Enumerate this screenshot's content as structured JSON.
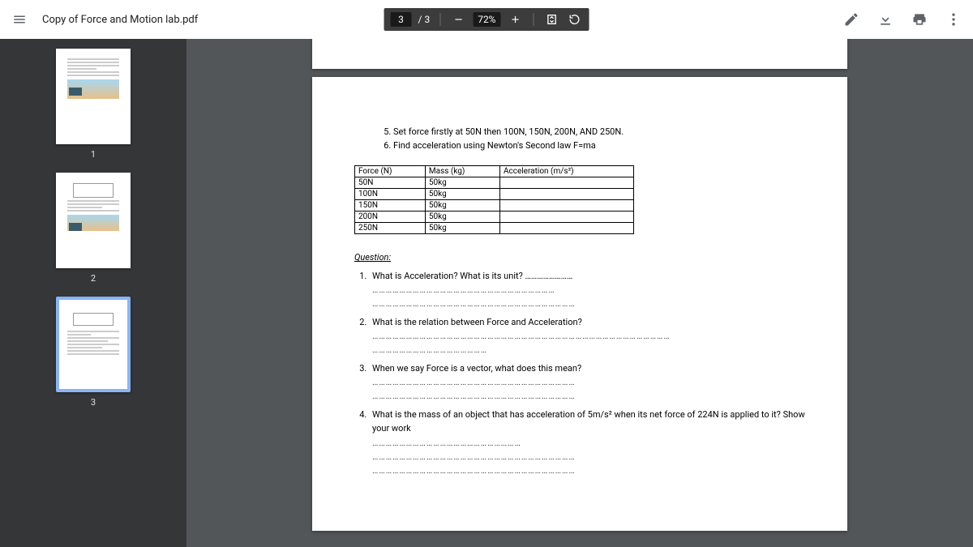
{
  "header": {
    "title": "Copy of Force and Motion lab.pdf",
    "page_current": "3",
    "page_total": "/ 3",
    "zoom": "72%"
  },
  "thumbnails": {
    "t1": "1",
    "t2": "2",
    "t3": "3"
  },
  "instructions": {
    "i5": "Set force firstly at 50N then 100N, 150N, 200N, AND 250N.",
    "i6": "Find acceleration using Newton's Second law F=ma"
  },
  "table": {
    "h1": "Force (N)",
    "h2": "Mass (kg)",
    "h3": "Acceleration (m/s²)",
    "r1c1": "50N",
    "r1c2": "50kg",
    "r2c1": "100N",
    "r2c2": "50kg",
    "r3c1": "150N",
    "r3c2": "50kg",
    "r4c1": "200N",
    "r4c2": "50kg",
    "r5c1": "250N",
    "r5c2": "50kg"
  },
  "questions": {
    "heading": "Question:",
    "q1": "What is Acceleration? What is its unit? ……………………",
    "q1b": "………………………………………………………………………",
    "q1c": "………………………………………………………………………………",
    "q2": "What is the relation between Force and Acceleration?",
    "q2b": "……………………………………………………………………………………………………………………",
    "q2c": "……………………………………………",
    "q3": "When we say Force is a vector, what does this mean?",
    "q3b": "………………………………………………………………………………",
    "q3c": "………………………………………………………………………………",
    "q4": "What is the mass of an object that has acceleration of 5m/s² when its net force of 224N is applied to it? Show your work",
    "q4b": "…………………………………………………………",
    "q4c": "………………………………………………………………………………",
    "q4d": "………………………………………………………………………………"
  }
}
